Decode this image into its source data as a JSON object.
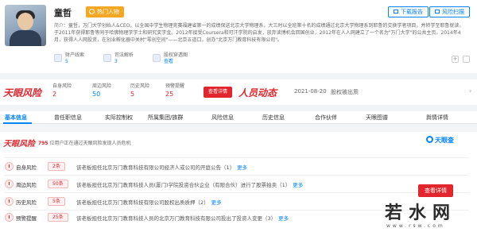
{
  "profile": {
    "name": "童哲",
    "tag": "热门人物",
    "intro_label": "简介：",
    "intro": "童哲，万门大学创始人&CEO。以全国中学生物理竞赛福建省第一的成绩保送北京大学物理系，大三时以全班第十名的成绩通过北京大学物理系到耶鲁的交换学者项目，并转学至耶鲁就读，于2011年获得耶鲁等同于哈佛物理学学士和研究奖学金。2012年接受Coursera和可汗学院的启发，放弃读博机会回国创业，2012年在人人网建立了一个名为\"万门大学\"的公共主页。2014年4月，获得人人网投资，在创业孵化器中关村\"零创空间\"——北京五道口，创办\"北京万门教育科技有限公司\"。",
    "buttons": {
      "download": "下载报告",
      "risk_scan": "风险扫描"
    },
    "stats": [
      {
        "label": "财产线索",
        "value": "5"
      },
      {
        "label": "司法解析",
        "value": "3"
      },
      {
        "label": "股权穿透图",
        "value": "查看"
      }
    ],
    "expand": "+"
  },
  "riskbar": {
    "brand": "天眼风险",
    "metrics": [
      {
        "label": "自身风险",
        "value": "2"
      },
      {
        "label": "周边风险",
        "value": "50"
      },
      {
        "label": "历史风险",
        "value": "5"
      },
      {
        "label": "预警提醒",
        "value": "25"
      }
    ],
    "detail_button": "查看详情",
    "dynamic_title": "人员动态",
    "dynamic_date": "2021-08-20",
    "dynamic_text": "股权被出质",
    "chevron": "›"
  },
  "tabs": [
    "基本信息",
    "曾任职信息",
    "实际控制权",
    "所属集团/族群",
    "风险信息",
    "历史信息",
    "合作伙伴",
    "天眼图谱",
    "舆情详情"
  ],
  "detail": {
    "brand": "天眼风险",
    "notice_count": "795",
    "notice_text": "位用户正在通过天眼风险发现人员危机",
    "logo": "天眼查",
    "view_button": "查看详情",
    "rows": [
      {
        "label": "自身风险",
        "level": "2条",
        "desc": "该老板担任北京万门教育科技有限公司经济人或公司的开庭公告（1）",
        "more": "更多"
      },
      {
        "label": "周边风险",
        "level": "50条",
        "desc": "该老板担任北京万门教育科技人员(厦门)学院投资合伙企业（有限合伙）进行了股票拍卖（1）",
        "more": "更多"
      },
      {
        "label": "历史风险",
        "level": "5条",
        "desc": "该老板担任北京万门教育科技有限公司股权出质质押（2）",
        "more": "更多"
      },
      {
        "label": "预警提醒",
        "level": "25条",
        "desc": "该老板担任北京万门教育科技人员的北京万门教育科技有限公司投出了投资人变更（3）",
        "more": "更多"
      }
    ]
  },
  "watermark": {
    "text": "若水网",
    "sub": "www.rsw.com"
  }
}
